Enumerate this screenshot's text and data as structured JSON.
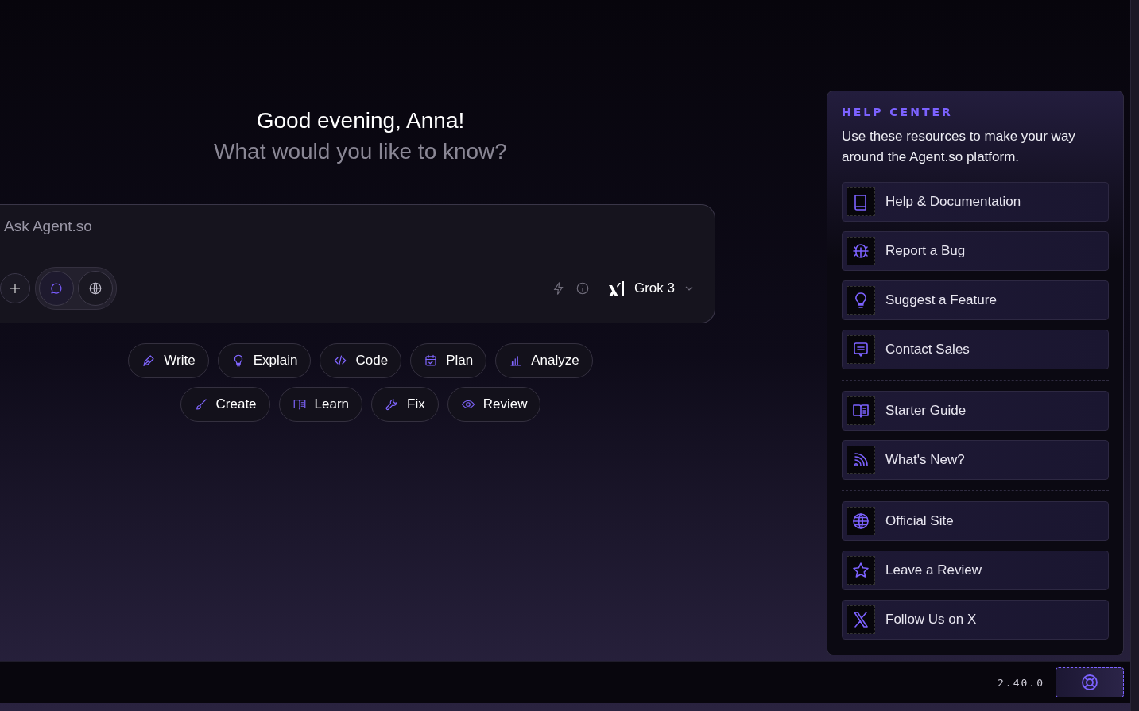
{
  "greeting": {
    "title": "Good evening, Anna!",
    "subtitle": "What would you like to know?"
  },
  "composer": {
    "placeholder": "Ask Agent.so",
    "modes": [
      {
        "kind": "chat",
        "selected": true
      },
      {
        "kind": "web",
        "selected": false
      }
    ],
    "model": "Grok 3"
  },
  "chip_rows": [
    [
      {
        "label": "Write",
        "kind": "pen"
      },
      {
        "label": "Explain",
        "kind": "bulb"
      },
      {
        "label": "Code",
        "kind": "code"
      },
      {
        "label": "Plan",
        "kind": "calendar"
      },
      {
        "label": "Analyze",
        "kind": "chart"
      }
    ],
    [
      {
        "label": "Create",
        "kind": "brush"
      },
      {
        "label": "Learn",
        "kind": "book-open"
      },
      {
        "label": "Fix",
        "kind": "wrench"
      },
      {
        "label": "Review",
        "kind": "eye"
      }
    ]
  ],
  "help_center": {
    "title": "HELP CENTER",
    "description": "Use these resources to make your way around the Agent.so platform.",
    "groups": [
      [
        {
          "label": "Help & Documentation",
          "kind": "book"
        },
        {
          "label": "Report a Bug",
          "kind": "bug"
        },
        {
          "label": "Suggest a Feature",
          "kind": "bulb"
        },
        {
          "label": "Contact Sales",
          "kind": "message"
        }
      ],
      [
        {
          "label": "Starter Guide",
          "kind": "book-open"
        },
        {
          "label": "What's New?",
          "kind": "rss"
        }
      ],
      [
        {
          "label": "Official Site",
          "kind": "globe"
        },
        {
          "label": "Leave a Review",
          "kind": "star"
        },
        {
          "label": "Follow Us on X",
          "kind": "x"
        }
      ]
    ]
  },
  "footer": {
    "version": "2.40.0"
  }
}
